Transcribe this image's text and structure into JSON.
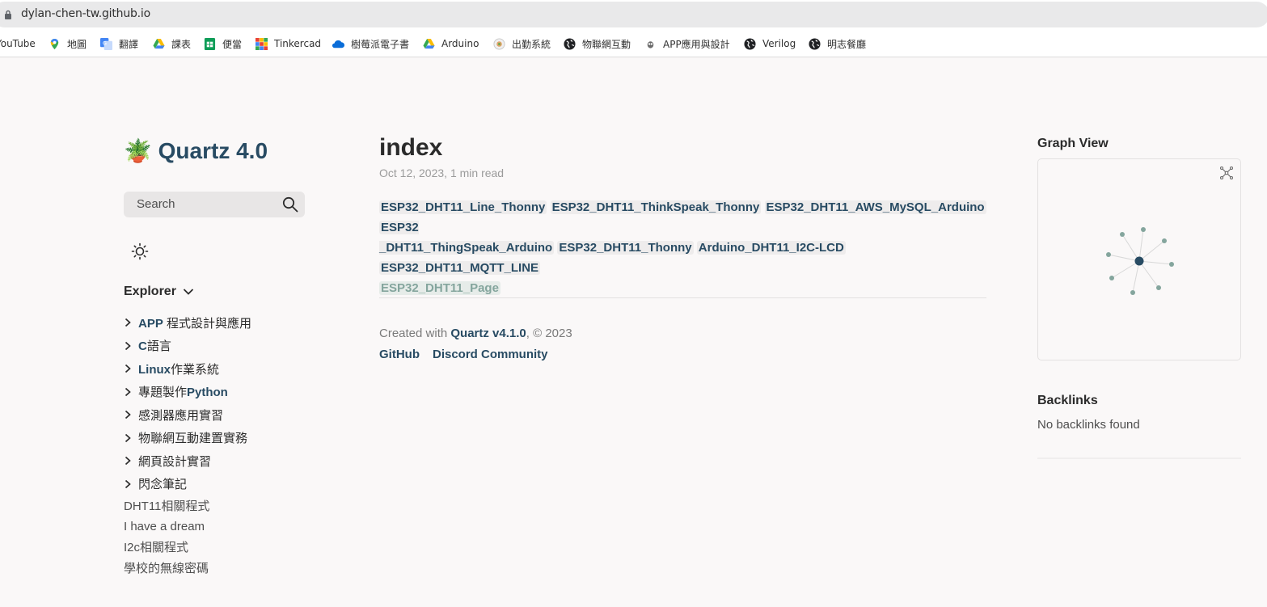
{
  "browser": {
    "url": "dylan-chen-tw.github.io",
    "bookmarks": [
      {
        "label": "YouTube",
        "icon": "youtube-icon"
      },
      {
        "label": "地圖",
        "icon": "maps-pin-icon"
      },
      {
        "label": "翻譯",
        "icon": "translate-icon"
      },
      {
        "label": "課表",
        "icon": "google-drive-icon"
      },
      {
        "label": "便當",
        "icon": "google-sheets-icon"
      },
      {
        "label": "Tinkercad",
        "icon": "tinkercad-icon"
      },
      {
        "label": "樹莓派電子書",
        "icon": "onedrive-icon"
      },
      {
        "label": "Arduino",
        "icon": "google-drive-icon"
      },
      {
        "label": "出勤系統",
        "icon": "attendance-icon"
      },
      {
        "label": "物聯網互動",
        "icon": "globe-icon"
      },
      {
        "label": "APP應用與設計",
        "icon": "app-inventor-icon"
      },
      {
        "label": "Verilog",
        "icon": "globe-icon"
      },
      {
        "label": "明志餐廳",
        "icon": "globe-icon"
      }
    ]
  },
  "sidebar": {
    "site_title": "🪴 Quartz 4.0",
    "search_placeholder": "Search",
    "explorer_title": "Explorer",
    "folders": [
      {
        "bold": "APP",
        "rest": " 程式設計與應用"
      },
      {
        "bold": "C",
        "rest": "語言"
      },
      {
        "bold": "Linux",
        "rest": "作業系統"
      },
      {
        "pre": "專題製作",
        "bold": "Python",
        "rest": ""
      },
      {
        "rest": "感測器應用實習"
      },
      {
        "rest": "物聯網互動建置實務"
      },
      {
        "rest": "網頁設計實習"
      },
      {
        "rest": "閃念筆記"
      }
    ],
    "files": [
      "DHT11相關程式",
      "I have a dream",
      "I2c相關程式",
      "學校的無線密碼"
    ]
  },
  "article": {
    "title": "index",
    "meta": "Oct 12, 2023, 1 min read",
    "links": [
      "ESP32_DHT11_Line_Thonny",
      "ESP32_DHT11_ThinkSpeak_Thonny",
      "ESP32_DHT11_AWS_MySQL_Arduino",
      "ESP32_DHT11_ThingSpeak_Arduino",
      "ESP32_DHT11_Thonny",
      "Arduino_DHT11_I2C-LCD",
      "ESP32_DHT11_MQTT_LINE",
      "ESP32_DHT11_Page"
    ],
    "link_line2_a": "ESP32",
    "link_line2_b": "_DHT11_ThingSpeak_Arduino"
  },
  "footer": {
    "created_prefix": "Created with ",
    "created_brand": "Quartz v4.1.0",
    "created_suffix": ", © 2023",
    "links": [
      "GitHub",
      "Discord Community"
    ]
  },
  "right": {
    "graph_title": "Graph View",
    "backlinks_title": "Backlinks",
    "backlinks_empty": "No backlinks found"
  },
  "colors": {
    "accent": "#284b63",
    "secondary_node": "#84a59d",
    "background": "#faf8f8"
  }
}
